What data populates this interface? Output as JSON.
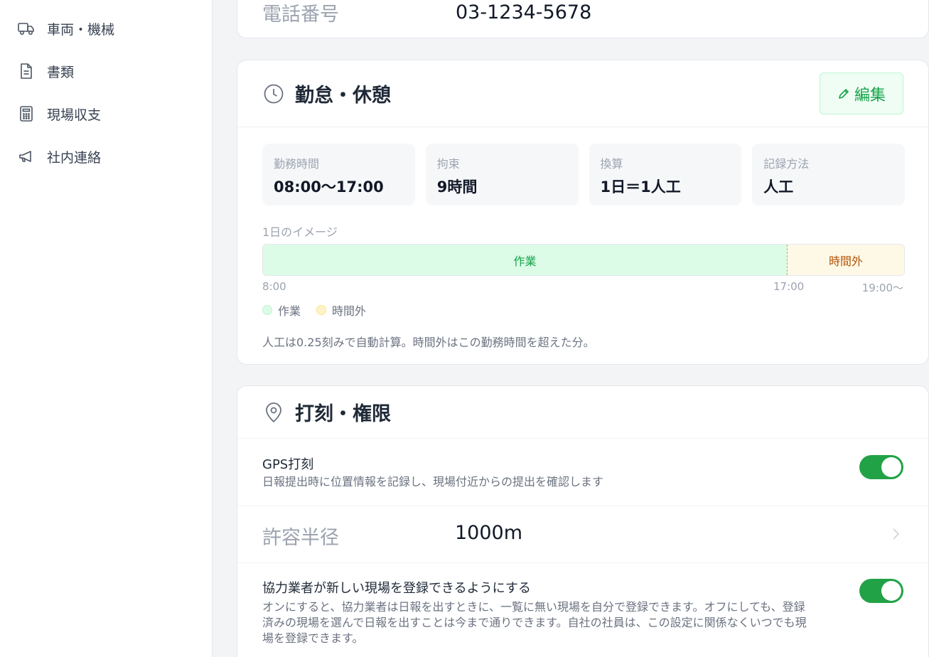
{
  "sidebar": {
    "items": [
      {
        "label": "車両・機械",
        "icon": "truck-icon"
      },
      {
        "label": "書類",
        "icon": "document-icon"
      },
      {
        "label": "現場収支",
        "icon": "calculator-icon"
      },
      {
        "label": "社内連絡",
        "icon": "megaphone-icon"
      }
    ]
  },
  "contact": {
    "phone_label": "電話番号",
    "phone_value": "03-1234-5678"
  },
  "attendance": {
    "title": "勤怠・休憩",
    "icon": "clock-icon",
    "edit_label": "編集",
    "stats": [
      {
        "label": "勤務時間",
        "value": "08:00〜17:00"
      },
      {
        "label": "拘束",
        "value": "9時間"
      },
      {
        "label": "換算",
        "value": "1日＝1人工"
      },
      {
        "label": "記録方法",
        "value": "人工"
      }
    ],
    "image_label": "1日のイメージ",
    "timeline": {
      "work_label": "作業",
      "overtime_label": "時間外",
      "ticks": [
        "8:00",
        "17:00",
        "19:00〜"
      ]
    },
    "legend": [
      {
        "label": "作業",
        "color": "#dcfce7"
      },
      {
        "label": "時間外",
        "color": "#fef3c7"
      }
    ],
    "note": "人工は0.25刻みで自動計算。時間外はこの勤務時間を超えた分。"
  },
  "permissions": {
    "title": "打刻・権限",
    "icon": "location-pin-icon",
    "gps": {
      "title": "GPS打刻",
      "desc": "日報提出時に位置情報を記録し、現場付近からの提出を確認します",
      "enabled": true
    },
    "radius": {
      "label": "許容半径",
      "value": "1000m"
    },
    "partner": {
      "title": "協力業者が新しい現場を登録できるようにする",
      "desc_line1": "オンにすると、協力業者は日報を出すときに、一覧に無い現場を自分で登録できます。オフにしても、登録",
      "desc_line2": "済みの現場を選んで日報を出すことは今まで通りできます。自社の社員は、この設定に関係なくいつでも現",
      "desc_line3": "場を登録できます。",
      "enabled": true
    }
  },
  "colors": {
    "accent": "#22a246",
    "edit_text": "#16a34a"
  }
}
